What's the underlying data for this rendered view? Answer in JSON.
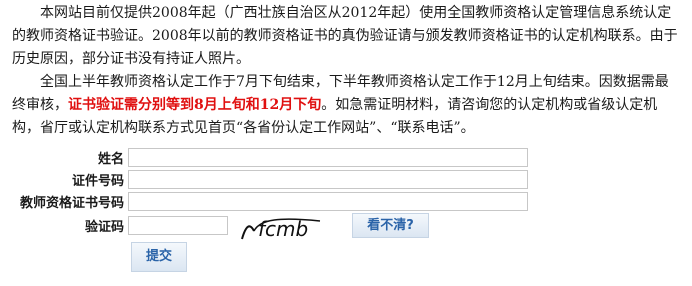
{
  "notice": {
    "para1": "本网站目前仅提供2008年起（广西壮族自治区从2012年起）使用全国教师资格认定管理信息系统认定的教师资格证书验证。2008年以前的教师资格证书的真伪验证请与颁发教师资格证书的认定机构联系。由于历史原因，部分证书没有持证人照片。",
    "para2_part1": "全国上半年教师资格认定工作于7月下旬结束，下半年教师资格认定工作于12月上旬结束。因数据需最终审核，",
    "para2_highlight": "证书验证需分别等到8月上旬和12月下旬",
    "para2_part2": "。如急需证明材料，请咨询您的认定机构或省级认定机构，省厅或认定机构联系方式见首页“各省份认定工作网站”、“联系电话”。"
  },
  "form": {
    "name_label": "姓名",
    "name_value": "",
    "id_label": "证件号码",
    "id_value": "",
    "cert_label": "教师资格证书号码",
    "cert_value": "",
    "captcha_label": "验证码",
    "captcha_value": "",
    "captcha_text": "fcmb",
    "refresh_label": "看不清?",
    "submit_label": "提交"
  },
  "colors": {
    "highlight": "#e01010",
    "button_text": "#2a63a8"
  }
}
